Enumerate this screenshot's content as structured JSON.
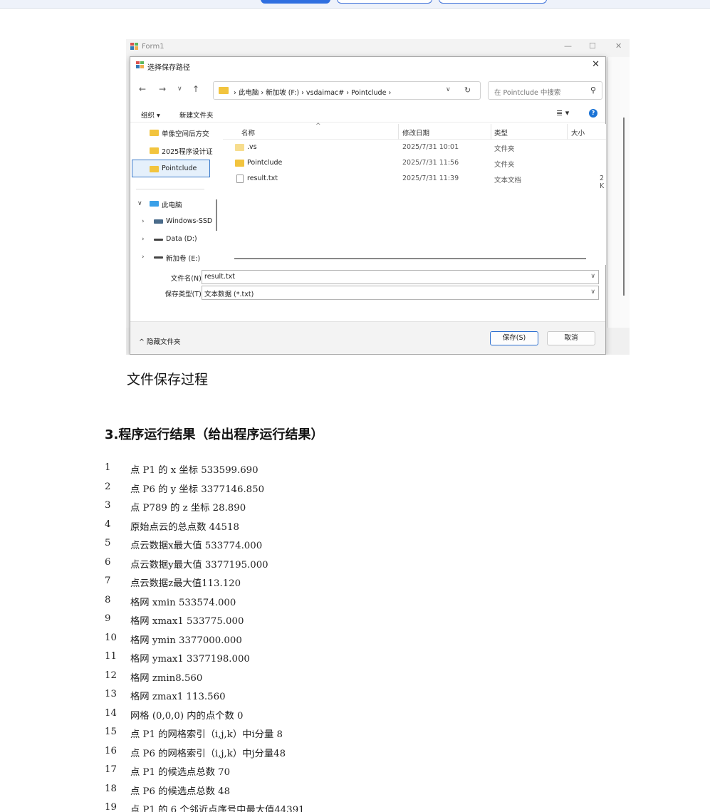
{
  "dialog": {
    "form_title": "Form1",
    "title": "选择保存路径",
    "address": {
      "crumbs": [
        "此电脑",
        "新加坡 (F:)",
        "vsdaimac#",
        "Pointclude"
      ]
    },
    "search_placeholder": "在 Pointclude 中搜索",
    "commands": {
      "organize": "组织 ▾",
      "new_folder": "新建文件夹"
    },
    "nav_items": [
      "单像空间后方交",
      "2025程序设计证",
      "Pointclude",
      "此电脑",
      "Windows-SSD",
      "Data (D:)",
      "新加卷 (E:)"
    ],
    "columns": {
      "name": "名称",
      "date": "修改日期",
      "type": "类型",
      "size": "大小"
    },
    "files": [
      {
        "name": ".vs",
        "date": "2025/7/31 10:01",
        "type": "文件夹",
        "size": ""
      },
      {
        "name": "Pointclude",
        "date": "2025/7/31 11:56",
        "type": "文件夹",
        "size": ""
      },
      {
        "name": "result.txt",
        "date": "2025/7/31 11:39",
        "type": "文本文档",
        "size": "2 K"
      }
    ],
    "filename_label": "文件名(N):",
    "filename_value": "result.txt",
    "filetype_label": "保存类型(T):",
    "filetype_value": "文本数据 (*.txt)",
    "hide_folders": "^ 隐藏文件夹",
    "save_button": "保存(S)",
    "cancel_button": "取消"
  },
  "caption": "文件保存过程",
  "heading": "3.程序运行结果（给出程序运行结果）",
  "results": [
    {
      "n": "1",
      "text": "点 P1 的 x 坐标 533599.690"
    },
    {
      "n": "2",
      "text": "点 P6 的 y 坐标 3377146.850"
    },
    {
      "n": "3",
      "text": "点 P789 的 z 坐标 28.890"
    },
    {
      "n": "4",
      "text": "原始点云的总点数 44518"
    },
    {
      "n": "5",
      "text": "点云数据x最大值 533774.000"
    },
    {
      "n": "6",
      "text": "点云数据y最大值 3377195.000"
    },
    {
      "n": "7",
      "text": "点云数据z最大值113.120"
    },
    {
      "n": "8",
      "text": "格网 xmin 533574.000"
    },
    {
      "n": "9",
      "text": "格网 xmax1 533775.000"
    },
    {
      "n": "10",
      "text": "格网 ymin 3377000.000"
    },
    {
      "n": "11",
      "text": "格网 ymax1 3377198.000"
    },
    {
      "n": "12",
      "text": "格网 zmin8.560"
    },
    {
      "n": "13",
      "text": "格网 zmax1 113.560"
    },
    {
      "n": "14",
      "text": "网格 (0,0,0) 内的点个数 0"
    },
    {
      "n": "15",
      "text": "点 P1 的网格索引（i,j,k）中i分量 8"
    },
    {
      "n": "16",
      "text": "点 P6 的网格索引（i,j,k）中j分量48"
    },
    {
      "n": "17",
      "text": "点 P1 的候选点总数 70"
    },
    {
      "n": "18",
      "text": "点 P6 的候选点总数 48"
    },
    {
      "n": "19",
      "text": "点 P1 的 6 个邻近点序号中最大值44391"
    }
  ]
}
